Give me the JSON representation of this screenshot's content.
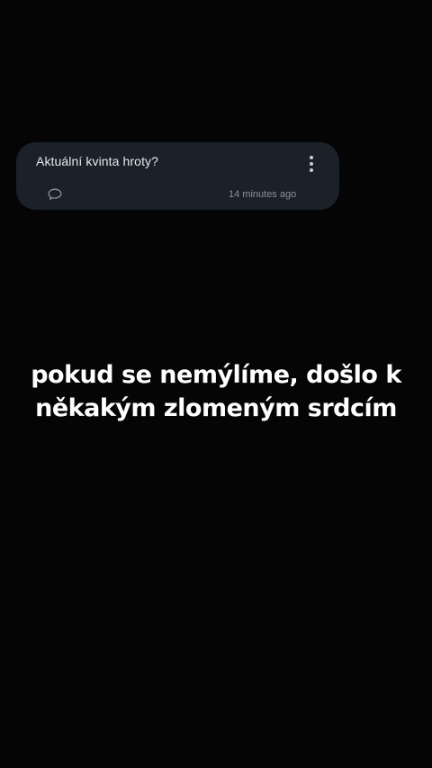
{
  "card": {
    "question": "Aktuální kvinta hroty?",
    "timestamp": "14 minutes ago",
    "icons": {
      "menu": "more-vertical-icon",
      "comment": "comment-bubble-icon"
    }
  },
  "caption": {
    "line1": "pokud se nemýlíme, došlo k",
    "line2": "někakým zlomeným srdcím"
  },
  "colors": {
    "background": "#050506",
    "card": "#1b2129",
    "text": "#e6e8eb",
    "muted": "#8a9099",
    "caption": "#ffffff"
  }
}
